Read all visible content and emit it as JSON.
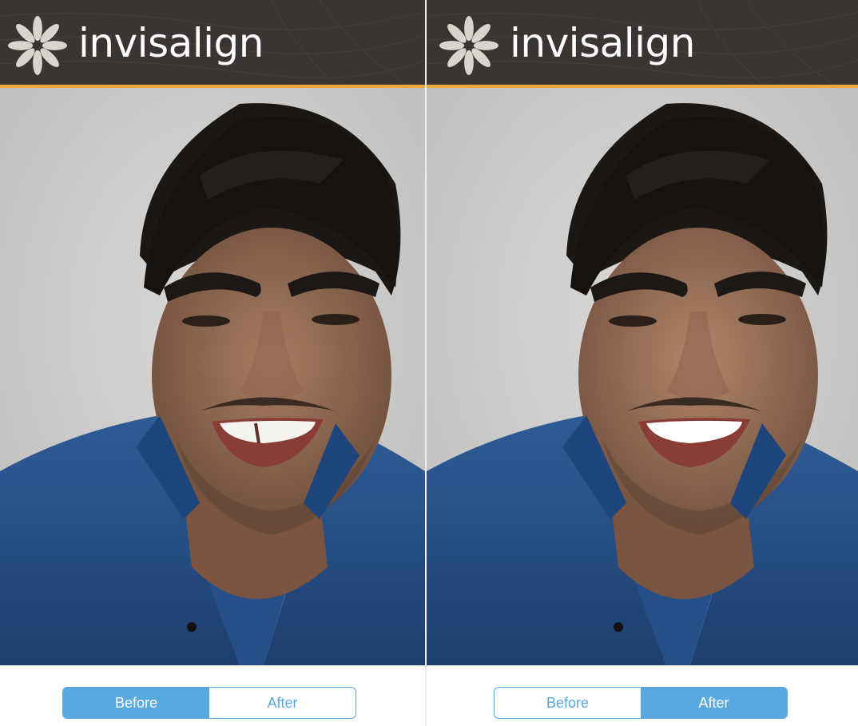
{
  "colors": {
    "header_bg": "#3a3532",
    "header_stripe": "#e8a83a",
    "segment_accent": "#5aa8e0",
    "background": "#ffffff"
  },
  "panels": [
    {
      "header": {
        "logo_icon": "invisalign-starburst-icon",
        "logo_text": "invisalign"
      },
      "photo": {
        "variant": "before"
      },
      "toggle": {
        "options": [
          {
            "label": "Before"
          },
          {
            "label": "After"
          }
        ],
        "selected": "Before"
      }
    },
    {
      "header": {
        "logo_icon": "invisalign-starburst-icon",
        "logo_text": "invisalign"
      },
      "photo": {
        "variant": "after"
      },
      "toggle": {
        "options": [
          {
            "label": "Before"
          },
          {
            "label": "After"
          }
        ],
        "selected": "After"
      }
    }
  ]
}
